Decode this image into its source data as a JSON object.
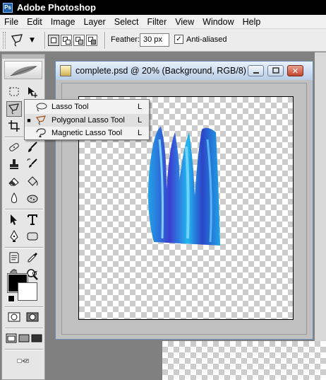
{
  "app": {
    "title": "Adobe Photoshop",
    "icon": "photoshop-icon"
  },
  "menu": [
    "File",
    "Edit",
    "Image",
    "Layer",
    "Select",
    "Filter",
    "View",
    "Window",
    "Help"
  ],
  "options": {
    "feather_label": "Feather:",
    "feather_value": "30 px",
    "antialias_label": "Anti-aliased",
    "antialias_checked": true
  },
  "document": {
    "title": "complete.psd @ 20% (Background, RGB/8)"
  },
  "flyout": {
    "items": [
      {
        "label": "Lasso Tool",
        "key": "L",
        "icon": "lasso-icon",
        "selected": false
      },
      {
        "label": "Polygonal Lasso Tool",
        "key": "L",
        "icon": "polygonal-lasso-icon",
        "selected": true
      },
      {
        "label": "Magnetic Lasso Tool",
        "key": "L",
        "icon": "magnetic-lasso-icon",
        "selected": false
      }
    ]
  },
  "colors": {
    "foreground": "#000000",
    "background": "#ffffff",
    "artwork_accent": "#1fa3e6"
  }
}
